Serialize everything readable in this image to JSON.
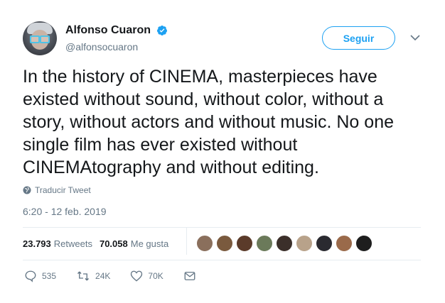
{
  "author": {
    "display_name": "Alfonso Cuaron",
    "handle": "@alfonsocuaron",
    "verified": true
  },
  "header": {
    "follow_label": "Seguir"
  },
  "tweet": {
    "text": "In the history of CINEMA, masterpieces have existed without sound, without color, without a story, without actors and without music. No one single film has ever existed without CINEMAtography and without editing.",
    "translate_label": "Traducir Tweet",
    "timestamp": "6:20 - 12 feb. 2019"
  },
  "stats": {
    "retweets_count": "23.793",
    "retweets_label": "Retweets",
    "likes_count": "70.058",
    "likes_label": "Me gusta"
  },
  "likers": [
    "#8a6f5c",
    "#7a5a3e",
    "#5b3b2a",
    "#6b7a5a",
    "#3b2f2a",
    "#b8a28a",
    "#2a2a30",
    "#9a6a4a",
    "#1e1e1e"
  ],
  "actions": {
    "reply_count": "535",
    "retweet_count": "24K",
    "like_count": "70K"
  },
  "colors": {
    "accent": "#1da1f2",
    "secondary_text": "#657786",
    "divider": "#e6ecf0"
  }
}
